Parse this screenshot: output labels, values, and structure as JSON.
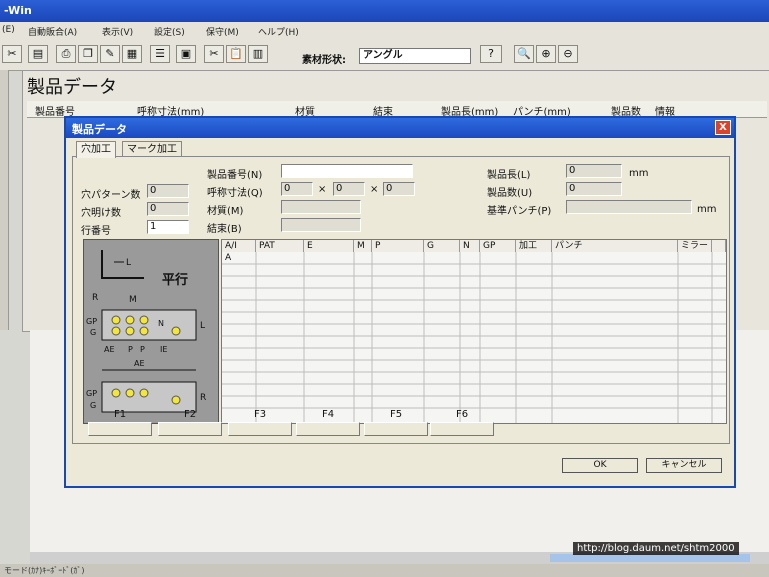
{
  "app": {
    "title": "-Win"
  },
  "menu": [
    "(E)",
    "自動販合(A)",
    "表示(V)",
    "設定(S)",
    "保守(M)",
    "ヘルプ(H)"
  ],
  "toolbar": {
    "shape_label": "素材形状:",
    "shape_value": "アングル"
  },
  "main": {
    "title": "製品データ",
    "columns": [
      "製品番号",
      "呼称寸法(mm)",
      "材質",
      "結束",
      "製品長(mm)",
      "パンチ(mm)",
      "製品数",
      "情報"
    ]
  },
  "dialog": {
    "title": "製品データ",
    "close_label": "X",
    "tabs": [
      "穴加工",
      "マーク加工"
    ],
    "fields": {
      "hole_pattern_count_label": "穴パターン数",
      "hole_pattern_count": "0",
      "hole_count_label": "穴明け数",
      "hole_count": "0",
      "row_number_label": "行番号",
      "row_number": "1",
      "product_no_label": "製品番号(N)",
      "product_no": "",
      "nominal_size_label": "呼称寸法(Q)",
      "nominal_a": "0",
      "nominal_b": "0",
      "nominal_c": "0",
      "times": "×",
      "material_label": "材質(M)",
      "material": "",
      "bundle_label": "結束(B)",
      "bundle": "",
      "length_label": "製品長(L)",
      "length": "0",
      "length_unit": "mm",
      "quantity_label": "製品数(U)",
      "quantity": "0",
      "punch_label": "基準パンチ(P)",
      "punch": "",
      "punch_unit": "mm"
    },
    "diagram": {
      "mode": "平行",
      "labels": [
        "L",
        "R",
        "M",
        "GP",
        "G",
        "N",
        "L",
        "AE",
        "P",
        "P",
        "IE",
        "AE",
        "GP",
        "G",
        "R"
      ]
    },
    "grid": {
      "columns": [
        "A/I",
        "PAT",
        "E",
        "M",
        "P",
        "G",
        "N",
        "GP",
        "加工",
        "パンチ",
        "ミラー"
      ],
      "first_cell": "A"
    },
    "fkeys": [
      "F1",
      "F2",
      "F3",
      "F4",
      "F5",
      "F6"
    ],
    "ok_label": "OK",
    "cancel_label": "キャンセル"
  },
  "watermark": "http://blog.daum.net/shtm2000",
  "status": "モード(ｶﾅ)ｷｰﾎﾞｰﾄﾞ(ｶﾞ)"
}
